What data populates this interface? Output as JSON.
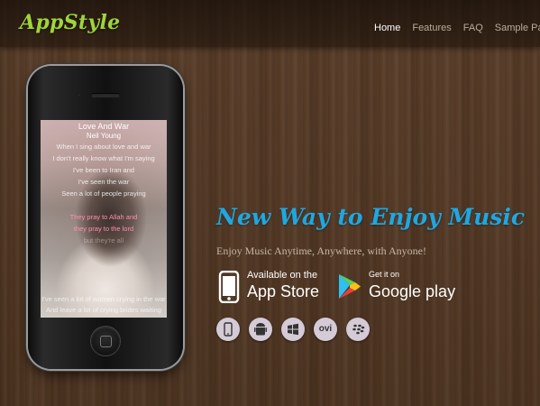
{
  "header": {
    "logo": "AppStyle",
    "nav": [
      {
        "label": "Home",
        "active": true
      },
      {
        "label": "Features",
        "active": false
      },
      {
        "label": "FAQ",
        "active": false
      },
      {
        "label": "Sample Page",
        "active": false
      }
    ]
  },
  "phone": {
    "song_title": "Love And War",
    "artist": "Neil Young",
    "lyrics": [
      "When I sing about love and war",
      "I don't really know what I'm saying",
      "I've been to Iran and",
      "I've seen the war",
      "Seen a lot of people praying"
    ],
    "lyrics_highlight": [
      "They pray to Allah and",
      "they pray to the lord"
    ],
    "lyrics_faded": "but they're all",
    "lyrics_bottom": [
      "I've seen a lot of women crying in the war",
      "And leave a lot of crying brides waiting"
    ]
  },
  "hero": {
    "tagline": "New Way to Enjoy Music",
    "subtitle": "Enjoy Music Anytime, Anywhere, with Anyone!",
    "app_store": {
      "pre": "Available on the",
      "main": "App Store"
    },
    "google_play": {
      "pre": "Get it on",
      "main": "Google play"
    },
    "platforms": [
      {
        "name": "iphone-icon"
      },
      {
        "name": "android-icon"
      },
      {
        "name": "windows-icon"
      },
      {
        "name": "ovi-icon",
        "text": "ovi"
      },
      {
        "name": "blackberry-icon"
      }
    ]
  },
  "colors": {
    "logo": "#9fd43a",
    "tagline": "#1fa7e1",
    "nav_active": "#ffffff",
    "nav_inactive": "#b9ac9b",
    "lyric_highlight": "#ff8fb0",
    "wood": "#553a26"
  }
}
